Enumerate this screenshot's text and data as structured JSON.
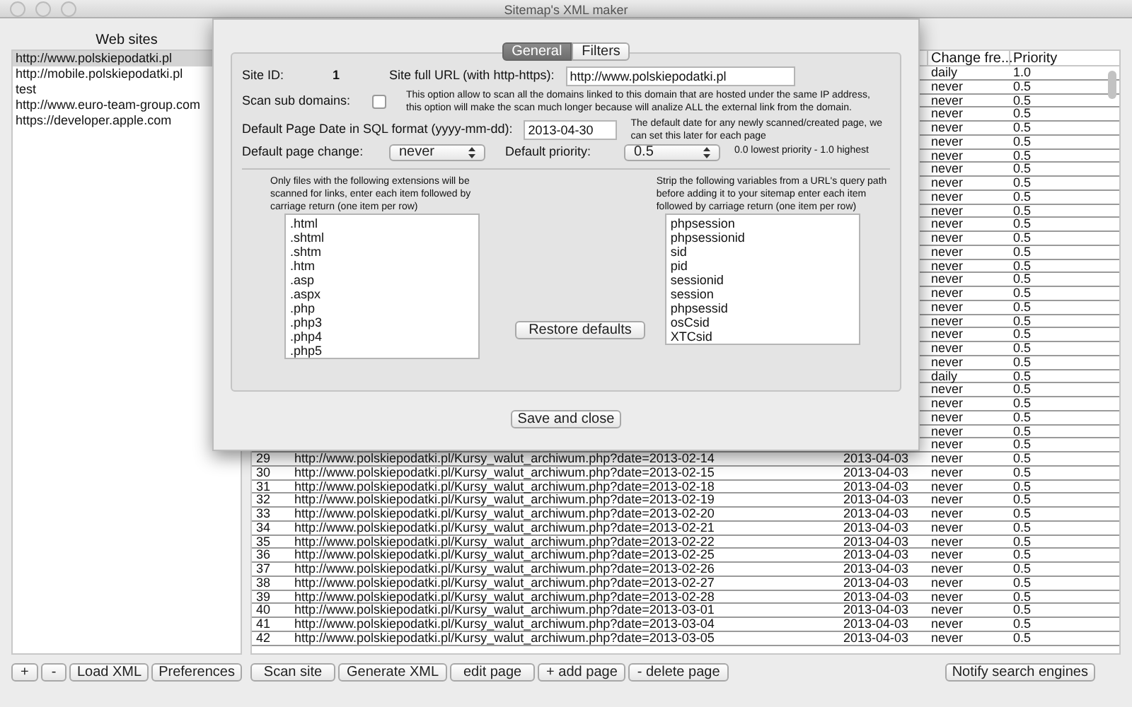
{
  "window": {
    "title": "Sitemap's XML maker"
  },
  "sites": {
    "title": "Web sites",
    "items": [
      {
        "label": "http://www.polskiepodatki.pl",
        "selected": true
      },
      {
        "label": "http://mobile.polskiepodatki.pl",
        "selected": false
      },
      {
        "label": "test",
        "selected": false
      },
      {
        "label": "http://www.euro-team-group.com",
        "selected": false
      },
      {
        "label": "https://developer.apple.com",
        "selected": false
      }
    ]
  },
  "table": {
    "columns": [
      "Change fre...",
      "Priority"
    ],
    "rows": [
      {
        "change": "daily",
        "priority": "1.0"
      },
      {
        "change": "never",
        "priority": "0.5"
      },
      {
        "change": "never",
        "priority": "0.5"
      },
      {
        "change": "never",
        "priority": "0.5"
      },
      {
        "change": "never",
        "priority": "0.5"
      },
      {
        "change": "never",
        "priority": "0.5"
      },
      {
        "change": "never",
        "priority": "0.5"
      },
      {
        "change": "never",
        "priority": "0.5"
      },
      {
        "change": "never",
        "priority": "0.5"
      },
      {
        "change": "never",
        "priority": "0.5"
      },
      {
        "change": "never",
        "priority": "0.5"
      },
      {
        "change": "never",
        "priority": "0.5"
      },
      {
        "change": "never",
        "priority": "0.5"
      },
      {
        "change": "never",
        "priority": "0.5"
      },
      {
        "change": "never",
        "priority": "0.5"
      },
      {
        "change": "never",
        "priority": "0.5"
      },
      {
        "change": "never",
        "priority": "0.5"
      },
      {
        "change": "never",
        "priority": "0.5"
      },
      {
        "change": "never",
        "priority": "0.5"
      },
      {
        "change": "never",
        "priority": "0.5"
      },
      {
        "change": "never",
        "priority": "0.5"
      },
      {
        "change": "never",
        "priority": "0.5"
      },
      {
        "change": "daily",
        "priority": "0.5"
      },
      {
        "change": "never",
        "priority": "0.5"
      },
      {
        "change": "never",
        "priority": "0.5"
      },
      {
        "change": "never",
        "priority": "0.5"
      },
      {
        "change": "never",
        "priority": "0.5"
      },
      {
        "change": "never",
        "priority": "0.5"
      },
      {
        "num": "29",
        "url": "http://www.polskiepodatki.pl/Kursy_walut_archiwum.php?date=2013-02-14",
        "date": "2013-04-03",
        "change": "never",
        "priority": "0.5"
      },
      {
        "num": "30",
        "url": "http://www.polskiepodatki.pl/Kursy_walut_archiwum.php?date=2013-02-15",
        "date": "2013-04-03",
        "change": "never",
        "priority": "0.5"
      },
      {
        "num": "31",
        "url": "http://www.polskiepodatki.pl/Kursy_walut_archiwum.php?date=2013-02-18",
        "date": "2013-04-03",
        "change": "never",
        "priority": "0.5"
      },
      {
        "num": "32",
        "url": "http://www.polskiepodatki.pl/Kursy_walut_archiwum.php?date=2013-02-19",
        "date": "2013-04-03",
        "change": "never",
        "priority": "0.5"
      },
      {
        "num": "33",
        "url": "http://www.polskiepodatki.pl/Kursy_walut_archiwum.php?date=2013-02-20",
        "date": "2013-04-03",
        "change": "never",
        "priority": "0.5"
      },
      {
        "num": "34",
        "url": "http://www.polskiepodatki.pl/Kursy_walut_archiwum.php?date=2013-02-21",
        "date": "2013-04-03",
        "change": "never",
        "priority": "0.5"
      },
      {
        "num": "35",
        "url": "http://www.polskiepodatki.pl/Kursy_walut_archiwum.php?date=2013-02-22",
        "date": "2013-04-03",
        "change": "never",
        "priority": "0.5"
      },
      {
        "num": "36",
        "url": "http://www.polskiepodatki.pl/Kursy_walut_archiwum.php?date=2013-02-25",
        "date": "2013-04-03",
        "change": "never",
        "priority": "0.5"
      },
      {
        "num": "37",
        "url": "http://www.polskiepodatki.pl/Kursy_walut_archiwum.php?date=2013-02-26",
        "date": "2013-04-03",
        "change": "never",
        "priority": "0.5"
      },
      {
        "num": "38",
        "url": "http://www.polskiepodatki.pl/Kursy_walut_archiwum.php?date=2013-02-27",
        "date": "2013-04-03",
        "change": "never",
        "priority": "0.5"
      },
      {
        "num": "39",
        "url": "http://www.polskiepodatki.pl/Kursy_walut_archiwum.php?date=2013-02-28",
        "date": "2013-04-03",
        "change": "never",
        "priority": "0.5"
      },
      {
        "num": "40",
        "url": "http://www.polskiepodatki.pl/Kursy_walut_archiwum.php?date=2013-03-01",
        "date": "2013-04-03",
        "change": "never",
        "priority": "0.5"
      },
      {
        "num": "41",
        "url": "http://www.polskiepodatki.pl/Kursy_walut_archiwum.php?date=2013-03-04",
        "date": "2013-04-03",
        "change": "never",
        "priority": "0.5"
      },
      {
        "num": "42",
        "url": "http://www.polskiepodatki.pl/Kursy_walut_archiwum.php?date=2013-03-05",
        "date": "2013-04-03",
        "change": "never",
        "priority": "0.5"
      }
    ]
  },
  "left_buttons": [
    "+",
    "-",
    "Load XML",
    "Preferences"
  ],
  "page_buttons": [
    "Scan site",
    "Generate XML",
    "edit page",
    "+ add page",
    "- delete page"
  ],
  "notify_button": "Notify search engines",
  "sheet": {
    "tabs": [
      {
        "label": "General",
        "selected": true
      },
      {
        "label": "Filters",
        "selected": false
      }
    ],
    "site_id_label": "Site ID:",
    "site_id": "1",
    "url_label": "Site full URL (with http-https):",
    "url": "http://www.polskiepodatki.pl",
    "scan_label": "Scan sub domains:",
    "scan_checked": false,
    "scan_note": "This option allow to scan all the domains linked to this domain that are hosted under the same IP address, this option will make the scan much longer because will analize ALL the external link from the domain.",
    "date_label": "Default Page Date in SQL format (yyyy-mm-dd):",
    "date": "2013-04-30",
    "date_note": "The default date for any newly scanned/created page, we can set this later for each page",
    "change_label": "Default page change:",
    "change": "never",
    "priority_label": "Default priority:",
    "priority": "0.5",
    "priority_note": "0.0 lowest priority - 1.0 highest",
    "ext_note": "Only files with the following extensions will be scanned for links, enter each item followed by carriage return (one item per row)",
    "extensions": [
      ".html",
      ".shtml",
      ".shtm",
      ".htm",
      ".asp",
      ".aspx",
      ".php",
      ".php3",
      ".php4",
      ".php5"
    ],
    "strip_note": "Strip the following variables from a URL's query path before adding it to your sitemap enter each item followed by carriage return (one item per row)",
    "variables": [
      "phpsession",
      "phpsessionid",
      "sid",
      "pid",
      "sessionid",
      "session",
      "phpsessid",
      "osCsid",
      "XTCsid"
    ],
    "restore_button": "Restore defaults",
    "save_button": "Save and close"
  }
}
